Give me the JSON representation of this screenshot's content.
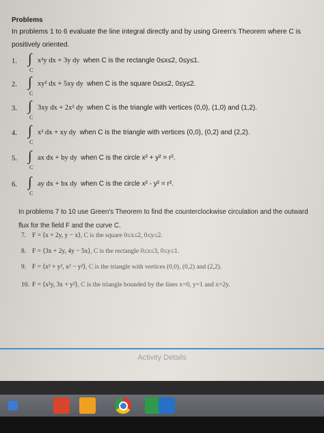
{
  "document": {
    "heading": "Problems",
    "intro": "In problems 1 to 6 evaluate the line integral directly and by using Green's Theorem where C is positively oriented.",
    "integral_sub": "C",
    "problems": [
      {
        "num": "1.",
        "expr": "x²y dx + 3y dy",
        "cond": "when C is the rectangle 0≤x≤2, 0≤y≤1."
      },
      {
        "num": "2.",
        "expr": "xy² dx + 5xy dy",
        "cond": "when C is the square 0≤x≤2, 0≤y≤2."
      },
      {
        "num": "3.",
        "expr": "3xy dx + 2x² dy",
        "cond": "when C is the triangle with vertices (0,0), (1,0) and (1,2)."
      },
      {
        "num": "4.",
        "expr": "x² dx + xy dy",
        "cond": "when C is the triangle with vertices (0,0), (0,2) and (2,2)."
      },
      {
        "num": "5.",
        "expr": "ax dx + by dy",
        "cond": "when C is the circle x² + y² = r²."
      },
      {
        "num": "6.",
        "expr": "ay dx + bx dy",
        "cond": "when C is the circle x² - y² = r²."
      }
    ],
    "intro2": "In problems 7 to 10 use Green's Theorem to find the counterclockwise circulation and the outward flux for the field F and the curve C.",
    "fields": [
      {
        "num": "7.",
        "f": "F = ⟨x + 2y, y − x⟩",
        "c": ", C is the square 0≤x≤2, 0≤y≤2."
      },
      {
        "num": "8.",
        "f": "F = ⟨3x + 2y, 4y − 5x⟩",
        "c": ", C is the rectangle 0≤x≤3, 0≤y≤1."
      },
      {
        "num": "9.",
        "f": "F = ⟨x² + y², x² − y²⟩",
        "c": ", C is the triangle with vertices (0,0), (0,2) and (2,2)."
      },
      {
        "num": "10.",
        "f": "F = ⟨x²y, 3x + y²⟩",
        "c": ", C is the triangle bounded by the lines x=0, y=1 and x=2y."
      }
    ]
  },
  "footer": {
    "activity": "Activity Details"
  },
  "taskbar": {
    "colors": [
      "#3b7bd6",
      "#d9452b",
      "#f0a020",
      "#e0362c",
      "#2f9a4a",
      "#2670c8"
    ],
    "icons": [
      "task-view-icon",
      "app-red-icon",
      "file-explorer-icon",
      "chrome-icon",
      "app-green-icon",
      "outlook-icon"
    ]
  }
}
